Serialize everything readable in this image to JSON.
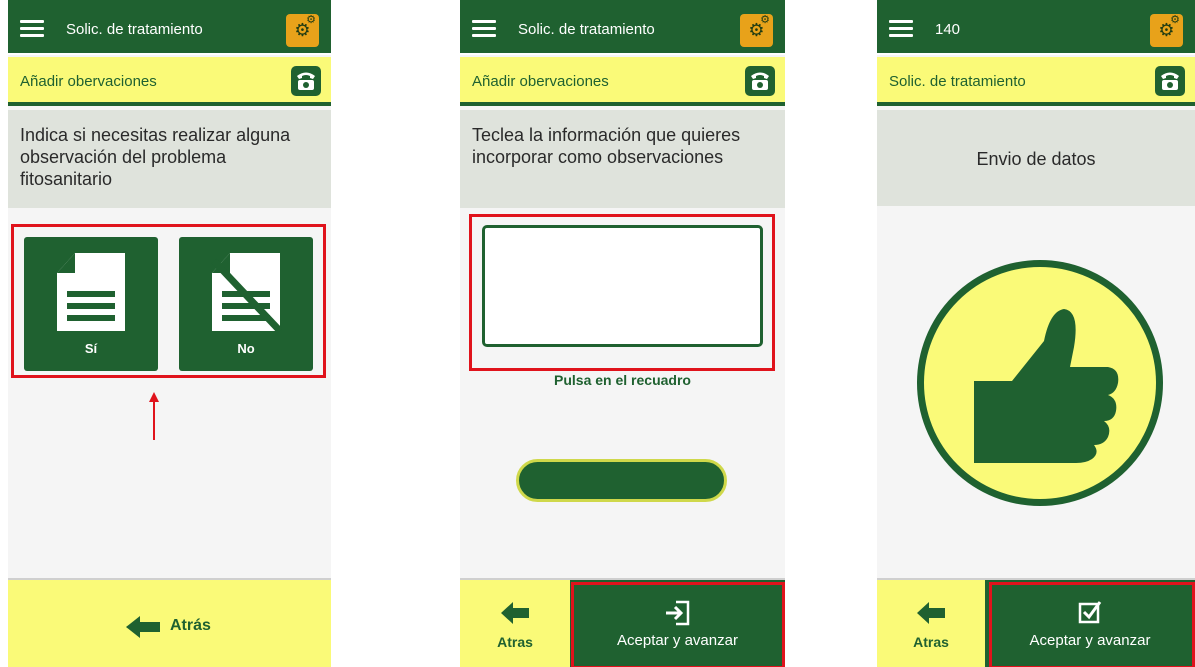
{
  "screen1": {
    "header_title": "Solic. de tratamiento",
    "subheader": "Añadir obervaciones",
    "prompt": "Indica si necesitas realizar alguna observación del problema fitosanitario",
    "option_yes": "Sí",
    "option_no": "No",
    "back_label": "Atrás"
  },
  "screen2": {
    "header_title": "Solic. de tratamiento",
    "subheader": "Añadir obervaciones",
    "prompt": "Teclea la información que quieres incorporar como observaciones",
    "hint": "Pulsa en el recuadro",
    "back_label": "Atras",
    "accept_label": "Aceptar y avanzar"
  },
  "screen3": {
    "header_title": "140",
    "subheader": "Solic. de tratamiento",
    "prompt": "Envio de datos",
    "back_label": "Atras",
    "accept_label": "Aceptar y avanzar"
  },
  "colors": {
    "primary_green": "#1f6130",
    "yellow": "#fafa78",
    "highlight_red": "#e0131c",
    "gear_orange": "#e8a21a"
  },
  "icons": [
    "menu-icon",
    "gear-icon",
    "phone-icon",
    "document-icon",
    "no-document-icon",
    "arrow-left-icon",
    "enter-icon",
    "checkbox-icon",
    "thumbs-up-icon"
  ]
}
